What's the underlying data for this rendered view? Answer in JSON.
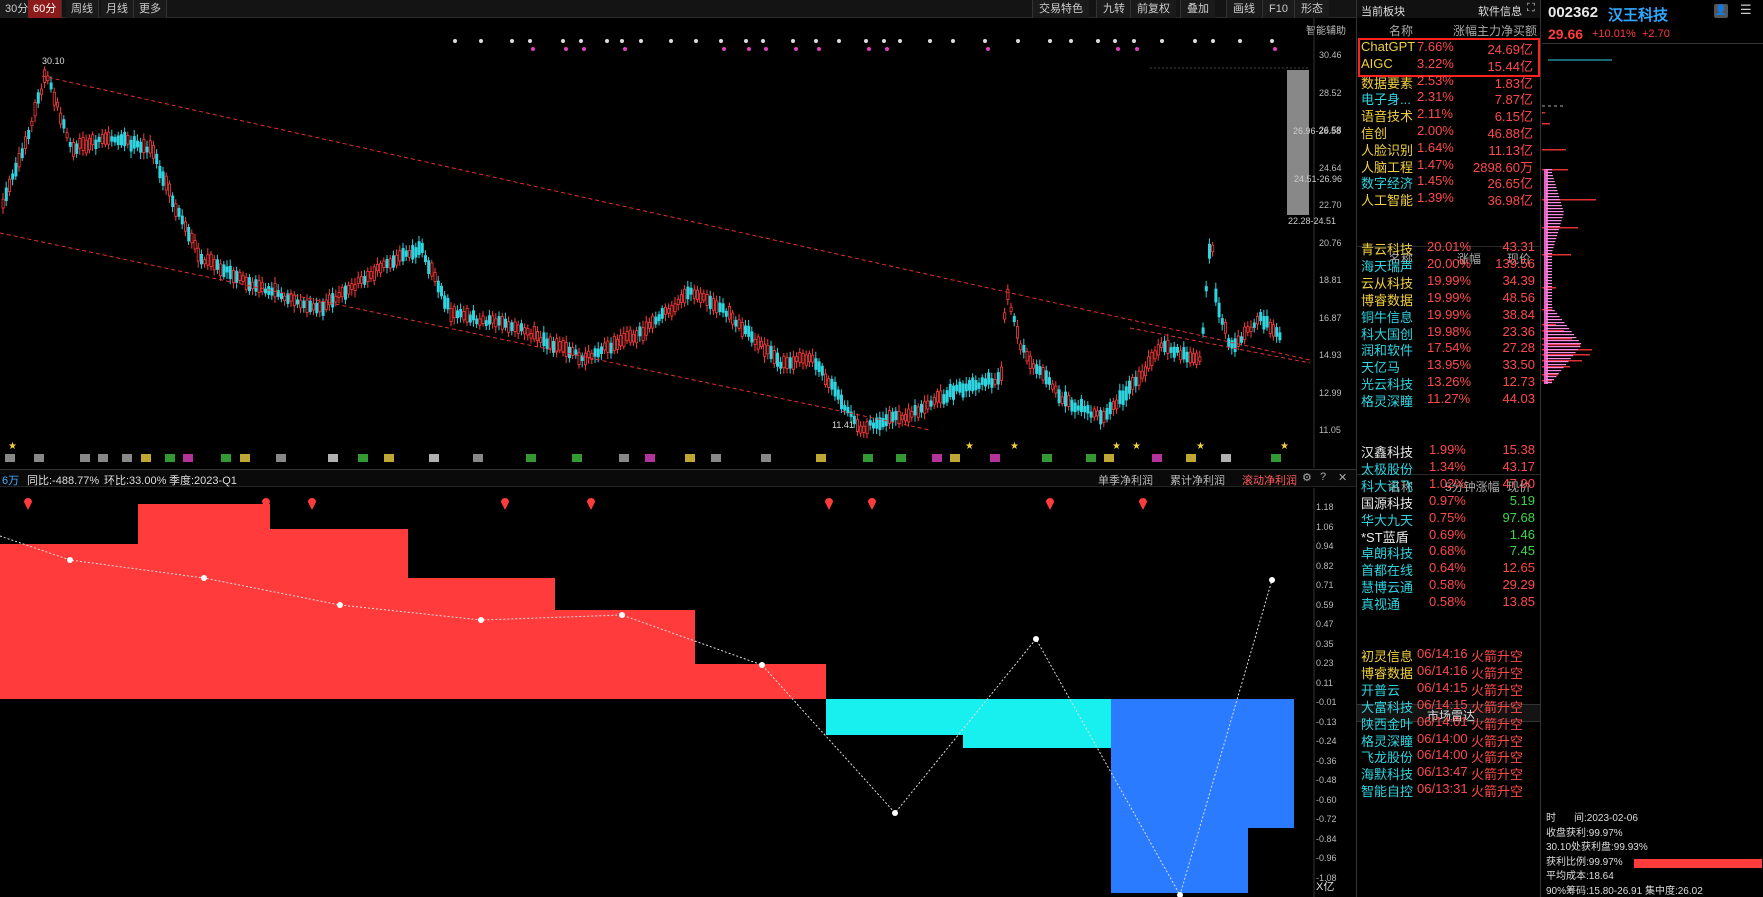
{
  "toolbar": {
    "left_buttons": [
      "30分",
      "60分",
      "周线",
      "月线",
      "更多"
    ],
    "active_index": 1,
    "right_buttons": [
      "交易特色",
      "九转",
      "前复权",
      "叠加",
      "画线",
      "F10",
      "形态"
    ],
    "assist_label": "智能辅助"
  },
  "price_axis": [
    "30.46",
    "28.52",
    "26.58",
    "24.64",
    "22.70",
    "20.76",
    "18.81",
    "16.87",
    "14.93",
    "12.99",
    "11.05"
  ],
  "price_annotations": {
    "high_label": "30.10",
    "low_label": "11.41",
    "r1": "26.96-26.58",
    "r2": "24.51-26.96",
    "r3": "22.28-24.51"
  },
  "lower": {
    "tag": "6万",
    "yoy": "同比:-488.77%",
    "qoq": "环比:33.00%",
    "quarter": "季度:2023-Q1",
    "tabs": [
      "单季净利润",
      "累计净利润",
      "滚动净利润"
    ],
    "active_tab": 2,
    "axis": [
      "1.18",
      "1.06",
      "0.94",
      "0.82",
      "0.71",
      "0.59",
      "0.47",
      "0.35",
      "0.23",
      "0.11",
      "-0.01",
      "-0.13",
      "-0.24",
      "-0.36",
      "-0.48",
      "-0.60",
      "-0.72",
      "-0.84",
      "-0.96",
      "-1.08"
    ],
    "unit": "X亿"
  },
  "sectors": {
    "title": "当前板块",
    "info": "软件信息",
    "headers": [
      "名称",
      "涨幅",
      "主力净买额"
    ],
    "rows": [
      {
        "name": "ChatGPT",
        "chg": "7.66%",
        "amt": "24.69亿",
        "highlight": true
      },
      {
        "name": "AIGC",
        "chg": "3.22%",
        "amt": "15.44亿",
        "highlight": true
      },
      {
        "name": "数据要素",
        "chg": "2.53%",
        "amt": "1.83亿"
      },
      {
        "name": "电子身...",
        "chg": "2.31%",
        "amt": "7.87亿"
      },
      {
        "name": "语音技术",
        "chg": "2.11%",
        "amt": "6.15亿"
      },
      {
        "name": "信创",
        "chg": "2.00%",
        "amt": "46.88亿"
      },
      {
        "name": "人脸识别",
        "chg": "1.64%",
        "amt": "11.13亿"
      },
      {
        "name": "人脑工程",
        "chg": "1.47%",
        "amt": "2898.60万"
      },
      {
        "name": "数字经济",
        "chg": "1.45%",
        "amt": "26.65亿"
      },
      {
        "name": "人工智能",
        "chg": "1.39%",
        "amt": "36.98亿"
      }
    ]
  },
  "gainers": {
    "headers": [
      "名称",
      "涨幅",
      "现价"
    ],
    "rows": [
      {
        "name": "青云科技",
        "chg": "20.01%",
        "price": "43.31"
      },
      {
        "name": "海天瑞声",
        "chg": "20.00%",
        "price": "139.56"
      },
      {
        "name": "云从科技",
        "chg": "19.99%",
        "price": "34.39"
      },
      {
        "name": "博睿数据",
        "chg": "19.99%",
        "price": "48.56"
      },
      {
        "name": "铜牛信息",
        "chg": "19.99%",
        "price": "38.84"
      },
      {
        "name": "科大国创",
        "chg": "19.98%",
        "price": "23.36"
      },
      {
        "name": "润和软件",
        "chg": "17.54%",
        "price": "27.28"
      },
      {
        "name": "天亿马",
        "chg": "13.95%",
        "price": "33.50"
      },
      {
        "name": "光云科技",
        "chg": "13.26%",
        "price": "12.73"
      },
      {
        "name": "格灵深瞳",
        "chg": "11.27%",
        "price": "44.03"
      }
    ]
  },
  "five_min": {
    "headers": [
      "名称",
      "5分钟涨幅",
      "现价"
    ],
    "rows": [
      {
        "name": "汉鑫科技",
        "chg": "1.99%",
        "price": "15.38"
      },
      {
        "name": "太极股份",
        "chg": "1.34%",
        "price": "43.17"
      },
      {
        "name": "科大讯飞",
        "chg": "1.02%",
        "price": "47.90"
      },
      {
        "name": "国源科技",
        "chg": "0.97%",
        "price": "5.19"
      },
      {
        "name": "华大九天",
        "chg": "0.75%",
        "price": "97.68"
      },
      {
        "name": "*ST蓝盾",
        "chg": "0.69%",
        "price": "1.46"
      },
      {
        "name": "卓朗科技",
        "chg": "0.68%",
        "price": "7.45"
      },
      {
        "name": "首都在线",
        "chg": "0.64%",
        "price": "12.65"
      },
      {
        "name": "慧博云通",
        "chg": "0.58%",
        "price": "29.29"
      },
      {
        "name": "真视通",
        "chg": "0.58%",
        "price": "13.85"
      }
    ]
  },
  "radar": {
    "title": "市场雷达",
    "rows": [
      {
        "name": "初灵信息",
        "time": "06/14:16",
        "event": "火箭升空"
      },
      {
        "name": "博睿数据",
        "time": "06/14:16",
        "event": "火箭升空"
      },
      {
        "name": "开普云",
        "time": "06/14:15",
        "event": "火箭升空"
      },
      {
        "name": "大富科技",
        "time": "06/14:15",
        "event": "火箭升空"
      },
      {
        "name": "陕西金叶",
        "time": "06/14:01",
        "event": "火箭升空"
      },
      {
        "name": "格灵深瞳",
        "time": "06/14:00",
        "event": "火箭升空"
      },
      {
        "name": "飞龙股份",
        "time": "06/14:00",
        "event": "火箭升空"
      },
      {
        "name": "海默科技",
        "time": "06/13:47",
        "event": "火箭升空"
      },
      {
        "name": "智能自控",
        "time": "06/13:31",
        "event": "火箭升空"
      }
    ]
  },
  "stock": {
    "code": "002362",
    "name": "汉王科技",
    "price": "29.66",
    "pct": "+10.01%",
    "change": "+2.70"
  },
  "chip": {
    "time_label": "时",
    "time_value": "间:2023-02-06",
    "lines": [
      "收盘获利:99.97%",
      "30.10处获利盘:99.93%",
      "获利比例:99.97%",
      "平均成本:18.64",
      "90%筹码:15.80-26.91 集中度:26.02"
    ]
  },
  "colors": {
    "up": "#ff3b3b",
    "down": "#2fd4e0",
    "blue": "#2a7bff",
    "highlight_border": "#ff2020"
  }
}
